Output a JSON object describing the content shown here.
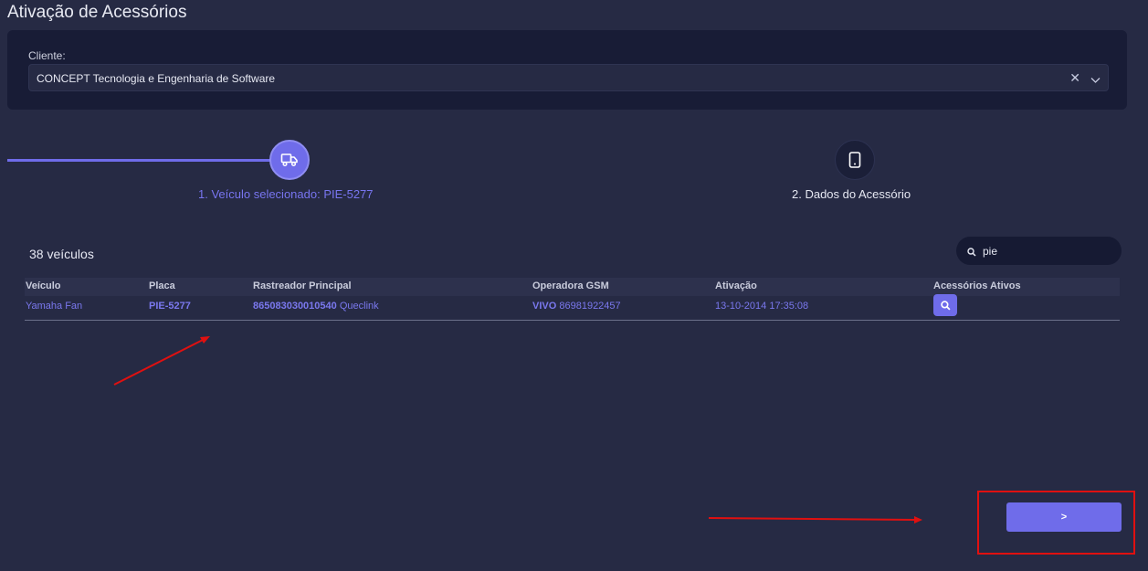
{
  "page": {
    "title": "Ativação de Acessórios"
  },
  "client": {
    "label": "Cliente:",
    "value": "CONCEPT Tecnologia e Engenharia de Software",
    "clear_icon": "close-icon",
    "dropdown_icon": "chevron-down-icon"
  },
  "stepper": {
    "steps": [
      {
        "label": "1. Veículo selecionado: PIE-5277",
        "icon": "truck-icon",
        "state": "active"
      },
      {
        "label": "2. Dados do Acessório",
        "icon": "tablet-icon",
        "state": "pending"
      }
    ]
  },
  "list": {
    "count_label": "38 veículos",
    "search": {
      "value": "pie",
      "icon": "search-icon"
    }
  },
  "table": {
    "columns": [
      "Veículo",
      "Placa",
      "Rastreador Principal",
      "Operadora GSM",
      "Ativação",
      "Acessórios Ativos"
    ],
    "rows": [
      {
        "veiculo": "Yamaha Fan",
        "placa": "PIE-5277",
        "rastreador_id": "865083030010540",
        "rastreador_modelo": "Queclink",
        "operadora": "VIVO",
        "linha": "86981922457",
        "ativacao": "13-10-2014 17:35:08",
        "acessorios_icon": "search-icon"
      }
    ]
  },
  "actions": {
    "next_label": ">"
  },
  "colors": {
    "background": "#262a44",
    "card": "#181c36",
    "accent": "#6f6cea",
    "annotation": "#e01010"
  }
}
